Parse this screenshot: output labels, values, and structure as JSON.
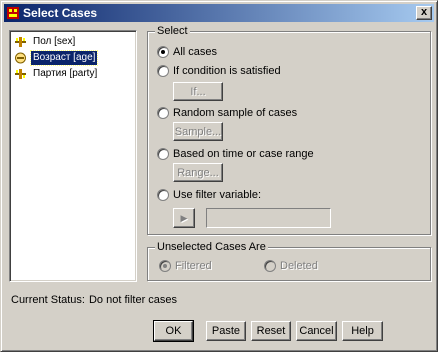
{
  "window": {
    "title": "Select Cases",
    "close_label": "x"
  },
  "variables": [
    {
      "label": "Пол [sex]",
      "selected": false
    },
    {
      "label": "Возраст [age]",
      "selected": true
    },
    {
      "label": "Партия [party]",
      "selected": false
    }
  ],
  "select_group": {
    "title": "Select",
    "options": [
      {
        "label": "All cases",
        "checked": true
      },
      {
        "label": "If condition is satisfied",
        "checked": false
      },
      {
        "label": "Random sample of cases",
        "checked": false
      },
      {
        "label": "Based on time or case range",
        "checked": false
      },
      {
        "label": "Use filter variable:",
        "checked": false
      }
    ],
    "if_button": "If...",
    "sample_button": "Sample...",
    "range_button": "Range...",
    "move_arrow": "▶",
    "filter_variable_value": ""
  },
  "unselected_group": {
    "title": "Unselected Cases Are",
    "filtered_label": "Filtered",
    "deleted_label": "Deleted",
    "filtered_checked": true
  },
  "status": {
    "label": "Current Status:",
    "value": "Do not filter cases"
  },
  "buttons": {
    "ok": "OK",
    "paste": "Paste",
    "reset": "Reset",
    "cancel": "Cancel",
    "help": "Help"
  },
  "colors": {
    "titlebar_start": "#0a246a",
    "titlebar_end": "#a6caf0",
    "face": "#d4d0c8",
    "selection": "#0a246a"
  }
}
